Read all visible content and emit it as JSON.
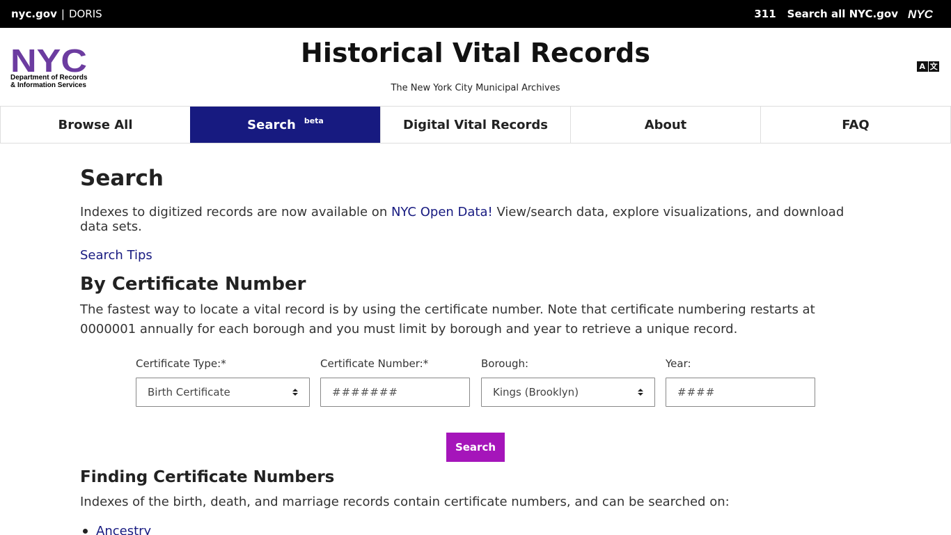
{
  "topbar": {
    "nycgov": "nyc.gov",
    "separator": "|",
    "doris": "DORIS",
    "t311": "311",
    "search_all": "Search all NYC.gov"
  },
  "header": {
    "logo_dept_line1": "Department of Records",
    "logo_dept_line2": "& Information Services",
    "title": "Historical Vital Records",
    "subtitle": "The New York City Municipal Archives",
    "translate_a": "A",
    "translate_b": "文"
  },
  "nav": {
    "tabs": [
      {
        "label": "Browse All"
      },
      {
        "label": "Search",
        "badge": "beta"
      },
      {
        "label": "Digital Vital Records"
      },
      {
        "label": "About"
      },
      {
        "label": "FAQ"
      }
    ]
  },
  "main": {
    "title": "Search",
    "intro_before": "Indexes to digitized records are now available on ",
    "intro_link": "NYC Open Data!",
    "intro_after": " View/search data, explore visualizations, and download data sets.",
    "tips": "Search Tips",
    "section_title": "By Certificate Number",
    "section_desc": "The fastest way to locate a vital record is by using the certificate number. Note that certificate numbering restarts at 0000001 annually for each borough and you must limit by borough and year to retrieve a unique record."
  },
  "form": {
    "cert_type_label": "Certificate Type:*",
    "cert_type_value": "Birth Certificate",
    "cert_number_label": "Certificate Number:*",
    "cert_number_placeholder": "#######",
    "borough_label": "Borough:",
    "borough_value": "Kings (Brooklyn)",
    "year_label": "Year:",
    "year_placeholder": "####",
    "search_button": "Search"
  },
  "finding": {
    "title": "Finding Certificate Numbers",
    "text": "Indexes of the birth, death, and marriage records contain certificate numbers, and can be searched on:",
    "items": [
      "Ancestry"
    ]
  },
  "colors": {
    "nav_active": "#171a80",
    "button": "#a515ba",
    "logo": "#6c3ca0",
    "link": "#171a80"
  }
}
